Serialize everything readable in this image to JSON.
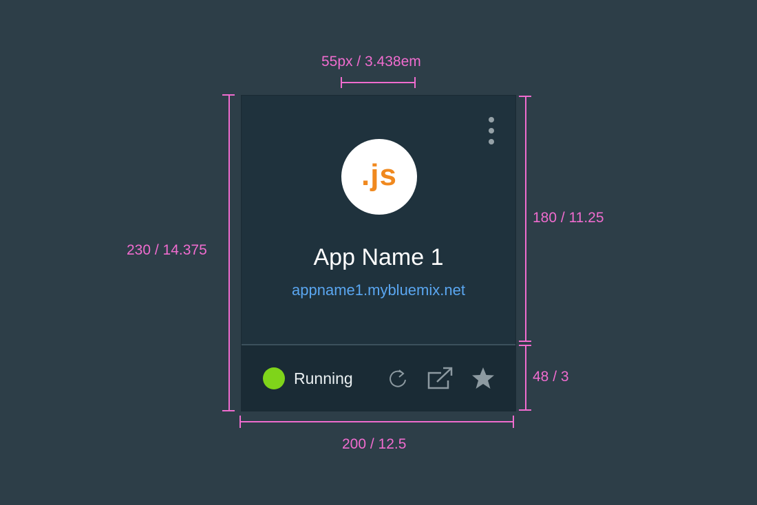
{
  "card": {
    "icon_text": ".js",
    "app_name": "App Name 1",
    "app_url": "appname1.mybluemix.net",
    "status": "Running",
    "status_color": "#7fd41a",
    "icon_bg": "#ffffff",
    "icon_text_color": "#f0891f",
    "url_color": "#5aa6f0",
    "actions": [
      {
        "name": "restart-icon"
      },
      {
        "name": "launch-icon"
      },
      {
        "name": "star-icon"
      }
    ],
    "overflow_menu_icon": "kebab-icon"
  },
  "annotations": {
    "icon_width": "55px / 3.438em",
    "total_height": "230 / 14.375",
    "body_height": "180 / 11.25",
    "footer_height": "48 / 3",
    "card_width": "200 / 12.5",
    "color": "#f06ccf"
  }
}
